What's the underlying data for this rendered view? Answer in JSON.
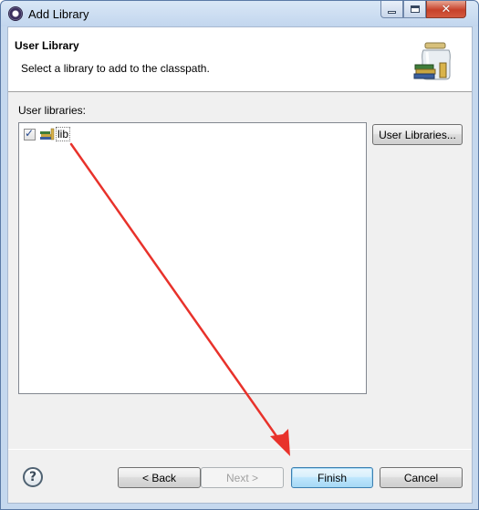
{
  "window": {
    "title": "Add Library",
    "close_glyph": "✕"
  },
  "header": {
    "title": "User Library",
    "description": "Select a library to add to the classpath.",
    "graphic": "library-jar-icon"
  },
  "list": {
    "label": "User libraries:",
    "items": [
      {
        "label": "lib",
        "checked": true,
        "icon": "library-books-icon"
      }
    ]
  },
  "buttons": {
    "user_libraries": "User Libraries...",
    "back": "< Back",
    "next": "Next >",
    "finish": "Finish",
    "cancel": "Cancel"
  },
  "icons": {
    "help": "?",
    "check": "✓"
  },
  "annotation": {
    "type": "arrow",
    "color": "#e8322b",
    "from": "lib",
    "to": "Finish"
  }
}
